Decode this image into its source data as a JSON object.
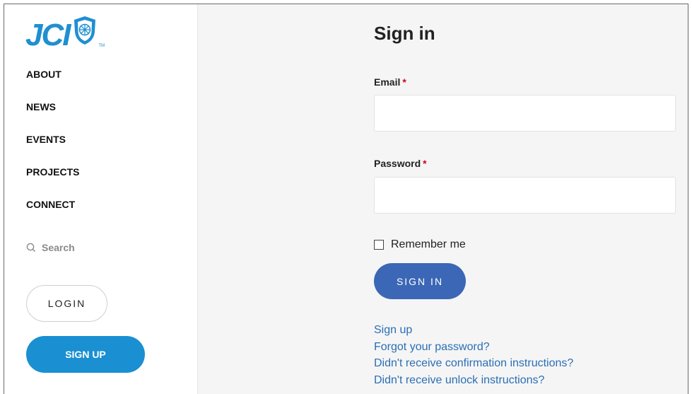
{
  "brand": {
    "logo_text": "JCI",
    "tm": "TM",
    "color": "#1f8fd1"
  },
  "sidebar": {
    "nav": [
      {
        "label": "ABOUT"
      },
      {
        "label": "NEWS"
      },
      {
        "label": "EVENTS"
      },
      {
        "label": "PROJECTS"
      },
      {
        "label": "CONNECT"
      }
    ],
    "search_label": "Search",
    "login_label": "LOGIN",
    "signup_label": "SIGN UP"
  },
  "form": {
    "title": "Sign in",
    "email_label": "Email",
    "email_value": "",
    "password_label": "Password",
    "password_value": "",
    "required_mark": "*",
    "remember_label": "Remember me",
    "remember_checked": false,
    "submit_label": "SIGN IN"
  },
  "links": [
    {
      "label": "Sign up"
    },
    {
      "label": "Forgot your password?"
    },
    {
      "label": "Didn't receive confirmation instructions?"
    },
    {
      "label": "Didn't receive unlock instructions?"
    }
  ],
  "colors": {
    "accent_blue": "#1a8fd2",
    "signin_button": "#3b67b6",
    "link": "#2a6fb5",
    "required": "#d0021b",
    "main_bg": "#f5f5f5"
  }
}
